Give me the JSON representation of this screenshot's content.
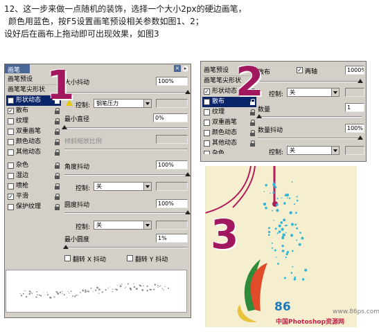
{
  "intro": {
    "line1": "12、这一步来做一点随机的装饰，选择一个大小2px的硬边画笔，",
    "line2": "颜色用蓝色，按F5设置画笔预设相关参数如图1、2；",
    "line3": "设好后在画布上拖动即可出现效果，如图3"
  },
  "panel1": {
    "tab": "画笔",
    "menu": "▸",
    "close": "×",
    "categories": [
      "画笔预设",
      "画笔笔尖形状"
    ],
    "items": [
      {
        "label": "形状动态",
        "checked": true,
        "selected": true
      },
      {
        "label": "散布",
        "checked": true,
        "selected": false
      },
      {
        "label": "纹理",
        "checked": false,
        "selected": false
      },
      {
        "label": "双重画笔",
        "checked": false,
        "selected": false
      },
      {
        "label": "颜色动态",
        "checked": false,
        "selected": false
      },
      {
        "label": "其他动态",
        "checked": false,
        "selected": false
      }
    ],
    "items2": [
      {
        "label": "杂色",
        "checked": false
      },
      {
        "label": "湿边",
        "checked": false
      },
      {
        "label": "喷枪",
        "checked": false
      },
      {
        "label": "平滑",
        "checked": true
      },
      {
        "label": "保护纹理",
        "checked": false
      }
    ],
    "size_jitter_label": "大小抖动",
    "size_jitter_value": "100%",
    "control_label": "控制:",
    "control_value": "钢笔压力",
    "min_diameter_label": "最小直径",
    "min_diameter_value": "0%",
    "tilt_scale_label": "倾斜缩放比例",
    "angle_jitter_label": "角度抖动",
    "angle_jitter_value": "100%",
    "angle_control_value": "关",
    "roundness_jitter_label": "圆度抖动",
    "roundness_jitter_value": "100%",
    "roundness_control_value": "关",
    "min_roundness_label": "最小圆度",
    "min_roundness_value": "1%",
    "flip_x_label": "翻转 X 抖动",
    "flip_y_label": "翻转 Y 抖动",
    "big_number": "1"
  },
  "panel2": {
    "categories": [
      "画笔预设",
      "画笔笔尖形状"
    ],
    "items": [
      {
        "label": "形状动态",
        "checked": true,
        "selected": false
      },
      {
        "label": "散布",
        "checked": true,
        "selected": true
      },
      {
        "label": "纹理",
        "checked": false,
        "selected": false
      },
      {
        "label": "双重画笔",
        "checked": false,
        "selected": false
      },
      {
        "label": "颜色动态",
        "checked": false,
        "selected": false
      },
      {
        "label": "其他动态",
        "checked": false,
        "selected": false
      }
    ],
    "scatter_label": "散布",
    "both_axes_label": "两轴",
    "scatter_value": "1000%",
    "control_label": "控制:",
    "control_value": "关",
    "count_label": "数量",
    "count_value": "1",
    "count_jitter_label": "数量抖动",
    "count_jitter_value": "100%",
    "count_control_value": "关",
    "partial_item": "杂色",
    "big_number": "2"
  },
  "canvas": {
    "big_number": "3",
    "watermark": "www.86ps.com",
    "logo": "86",
    "brand": "中国Photoshop资源网"
  },
  "colors": {
    "panel_bg": "#d4d0c8",
    "title_bar": "#4a6797",
    "selection": "#0a246a",
    "number_color": "#a2185e",
    "canvas_bg": "#f6efcf",
    "dots": "#33b6d6"
  }
}
